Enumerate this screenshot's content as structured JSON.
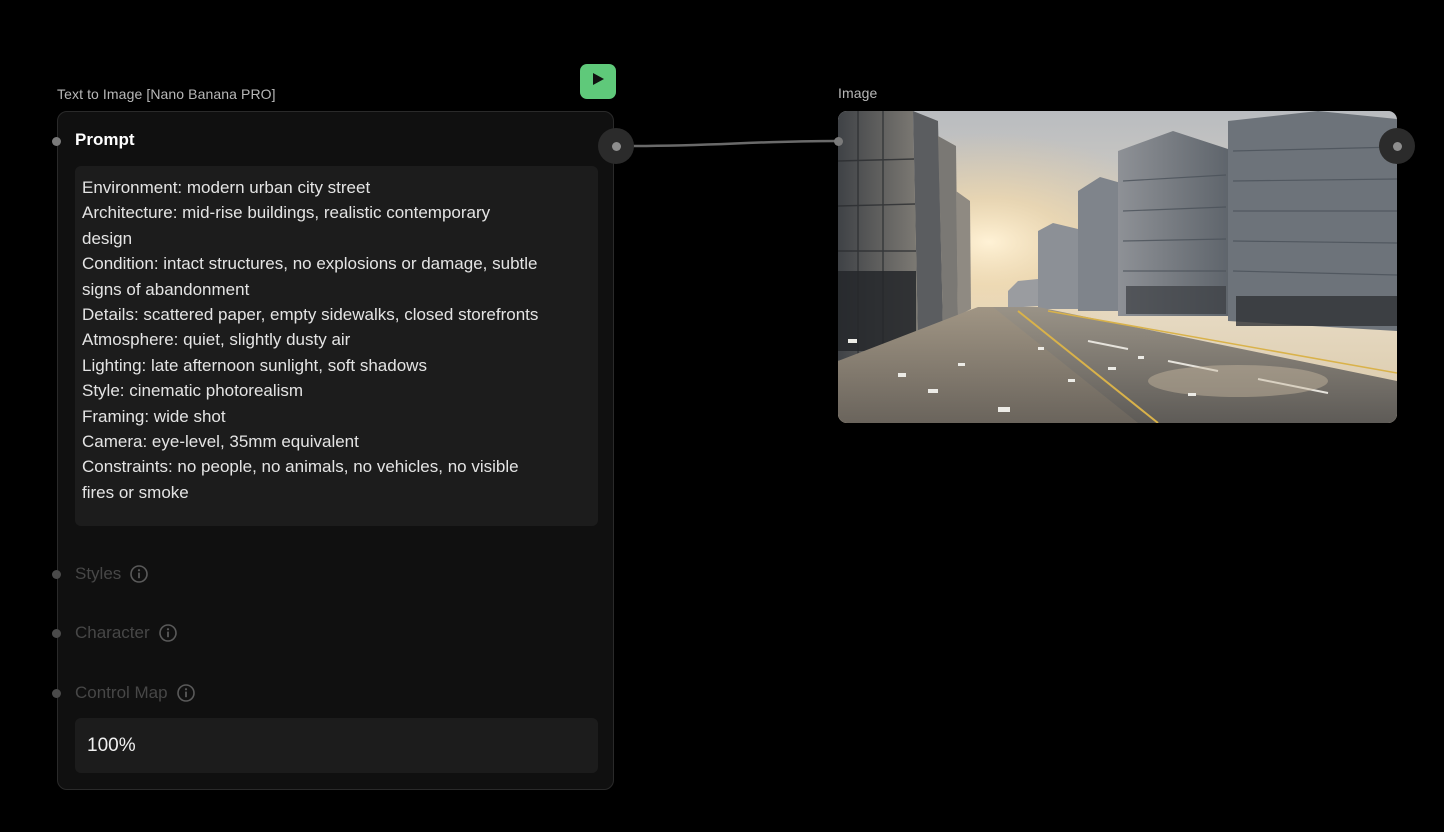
{
  "text_to_image_node": {
    "title": "Text to Image [Nano Banana PRO]",
    "run_button_icon": "play-icon",
    "prompt": {
      "label": "Prompt",
      "lines": [
        "Environment: modern urban city street",
        "Architecture: mid-rise buildings, realistic contemporary",
        "design",
        "Condition: intact structures, no explosions or damage, subtle",
        "signs of abandonment",
        "Details: scattered paper, empty sidewalks, closed storefronts",
        "Atmosphere: quiet, slightly dusty air",
        "Lighting: late afternoon sunlight, soft shadows",
        "Style: cinematic photorealism",
        "Framing: wide shot",
        "Camera: eye-level, 35mm equivalent",
        "Constraints: no people, no animals, no vehicles, no visible",
        "fires or smoke"
      ]
    },
    "styles_label": "Styles",
    "character_label": "Character",
    "control_map_label": "Control Map",
    "control_strength": "100%"
  },
  "image_node": {
    "title": "Image"
  },
  "colors": {
    "canvas": "#000000",
    "node_bg": "#101010",
    "field_bg": "#1c1c1c",
    "run_button": "#5fc97a",
    "disabled_text": "#474747"
  }
}
